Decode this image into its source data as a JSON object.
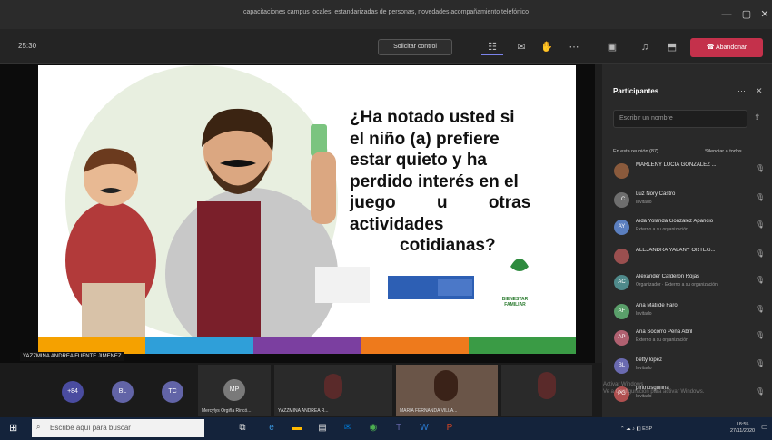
{
  "window": {
    "title": "capacitaciones campus locales, estandarizadas de personas, novedades acompañamiento telefónico",
    "minimize_icon": "minimize-icon",
    "maximize_icon": "maximize-icon",
    "close_icon": "close-icon"
  },
  "toolbar": {
    "time": "25:30",
    "request_control": "Solicitar control",
    "leave_label": "Abandonar",
    "colors": {
      "leave": "#c4314b"
    }
  },
  "slide": {
    "question": [
      "¿Ha notado usted si",
      "el niño (a) prefiere",
      "estar quieto y ha",
      "perdido interés en el",
      "juego u otras",
      "actividades",
      "cotidianas?"
    ],
    "logo_text": "BIENESTAR FAMILIAR",
    "colorbar": [
      "#f5a100",
      "#2f9fd9",
      "#7b3fa0",
      "#ee7a1c",
      "#3a9b45"
    ]
  },
  "presenter": {
    "label": "YAZZMINA ANDREA FUENTE JIMENEZ"
  },
  "participants": {
    "title": "Participantes",
    "invite_placeholder": "Escribir un nombre",
    "in_meeting": "En esta reunión (87)",
    "mute_all": "Silenciar a todos",
    "people": [
      {
        "name": "MARLENY LUCIA GONZALEZ ...",
        "sub": "",
        "initials": "",
        "color": "#8a5a3c"
      },
      {
        "name": "Luz Nory Castro",
        "sub": "Invitado",
        "initials": "LC",
        "color": "#6e6e6e"
      },
      {
        "name": "Aida Yolanda Gonzalez Aparicio",
        "sub": "Externo a su organización",
        "initials": "AY",
        "color": "#5b7fbf"
      },
      {
        "name": "ALEJANDRA YALANY ORTEG...",
        "sub": "",
        "initials": "",
        "color": "#9a4f4f"
      },
      {
        "name": "Alexander Calderon Rojas",
        "sub": "Organizador · Externo a su organización",
        "initials": "AC",
        "color": "#4f8a8b"
      },
      {
        "name": "Ana Matilde Faro",
        "sub": "Invitado",
        "initials": "AF",
        "color": "#5a9f6a"
      },
      {
        "name": "Ana Socorro Peña Abril",
        "sub": "Externo a su organización",
        "initials": "AP",
        "color": "#b06070"
      },
      {
        "name": "betty lopez",
        "sub": "Invitado",
        "initials": "BL",
        "color": "#6a6ab0"
      },
      {
        "name": "pirithpsguillna",
        "sub": "Invitado",
        "initials": "PG",
        "color": "#b05050"
      }
    ]
  },
  "strip": {
    "more_count": "+84",
    "circles": [
      "BL",
      "TC",
      "MP"
    ],
    "tile_labels": [
      "Mercylys Orgiña Rincó...",
      "YAZZMINA ANDREA R...",
      "MARIA FERNANDA VILLA..."
    ]
  },
  "watermark": [
    "Activar Windows",
    "Ve a Configuración para activar Windows."
  ],
  "taskbar": {
    "search_placeholder": "Escribe aquí para buscar",
    "tray": "ESP",
    "time": "18:55",
    "date": "27/11/2020"
  }
}
